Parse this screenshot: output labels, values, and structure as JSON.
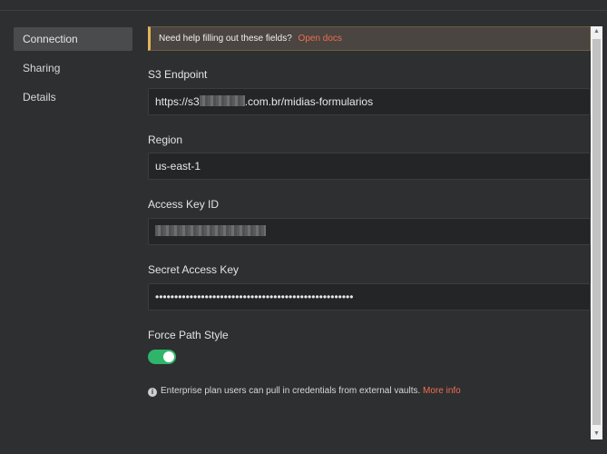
{
  "sidebar": {
    "items": [
      {
        "label": "Connection"
      },
      {
        "label": "Sharing"
      },
      {
        "label": "Details"
      }
    ]
  },
  "notice": {
    "text": "Need help filling out these fields?",
    "link": "Open docs"
  },
  "fields": {
    "s3_endpoint": {
      "label": "S3 Endpoint",
      "value_prefix": "https://s3",
      "value_suffix": ".com.br/midias-formularios"
    },
    "region": {
      "label": "Region",
      "value": "us-east-1"
    },
    "access_key_id": {
      "label": "Access Key ID"
    },
    "secret_access_key": {
      "label": "Secret Access Key",
      "value": "••••••••••••••••••••••••••••••••••••••••••••••••••••"
    },
    "force_path_style": {
      "label": "Force Path Style",
      "enabled": true
    }
  },
  "info": {
    "text": "Enterprise plan users can pull in credentials from external vaults.",
    "link": "More info"
  },
  "colors": {
    "accent_link": "#ef6d51",
    "toggle_on": "#2fb56b",
    "notice_border": "#e2b55a"
  },
  "icons": {
    "info": "info-circle-icon"
  }
}
